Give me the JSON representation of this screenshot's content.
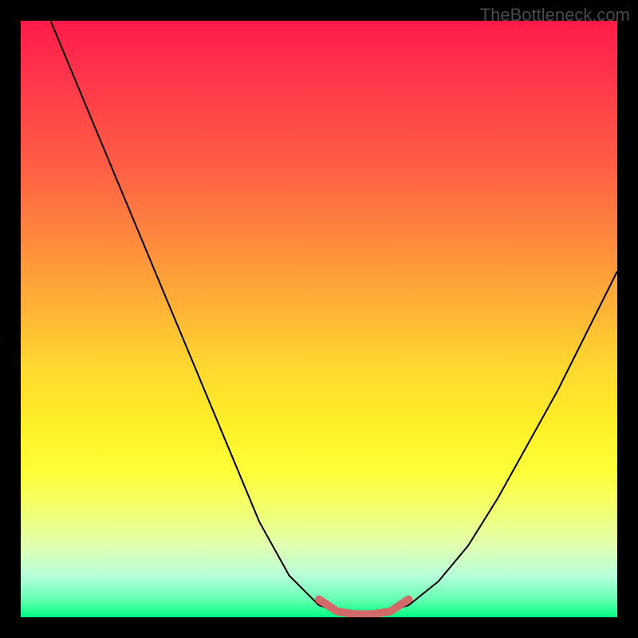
{
  "watermark": "TheBottleneck.com",
  "chart_data": {
    "type": "line",
    "title": "",
    "xlabel": "",
    "ylabel": "",
    "xlim": [
      0,
      100
    ],
    "ylim": [
      0,
      100
    ],
    "grid": false,
    "legend": false,
    "annotations": [],
    "series": [
      {
        "name": "main-curve",
        "stroke": "#000000",
        "points": [
          {
            "x": 5,
            "y": 100
          },
          {
            "x": 10,
            "y": 88
          },
          {
            "x": 15,
            "y": 76
          },
          {
            "x": 20,
            "y": 64
          },
          {
            "x": 25,
            "y": 52
          },
          {
            "x": 30,
            "y": 40
          },
          {
            "x": 35,
            "y": 28
          },
          {
            "x": 40,
            "y": 16
          },
          {
            "x": 45,
            "y": 7
          },
          {
            "x": 50,
            "y": 2
          },
          {
            "x": 55,
            "y": 0.5
          },
          {
            "x": 60,
            "y": 0.5
          },
          {
            "x": 65,
            "y": 2
          },
          {
            "x": 70,
            "y": 6
          },
          {
            "x": 75,
            "y": 12
          },
          {
            "x": 80,
            "y": 20
          },
          {
            "x": 85,
            "y": 29
          },
          {
            "x": 90,
            "y": 38
          },
          {
            "x": 95,
            "y": 48
          },
          {
            "x": 100,
            "y": 58
          }
        ]
      },
      {
        "name": "valley-highlight",
        "stroke": "#d26a6a",
        "points": [
          {
            "x": 50,
            "y": 3
          },
          {
            "x": 53,
            "y": 1
          },
          {
            "x": 56,
            "y": 0.5
          },
          {
            "x": 59,
            "y": 0.5
          },
          {
            "x": 62,
            "y": 1
          },
          {
            "x": 65,
            "y": 3
          }
        ]
      }
    ],
    "background_gradient": {
      "type": "vertical",
      "stops": [
        {
          "pos": 0,
          "color": "#ff1a4a"
        },
        {
          "pos": 25,
          "color": "#ff6044"
        },
        {
          "pos": 50,
          "color": "#ffb236"
        },
        {
          "pos": 70,
          "color": "#fff028"
        },
        {
          "pos": 90,
          "color": "#e0ffb0"
        },
        {
          "pos": 100,
          "color": "#00ff80"
        }
      ]
    }
  }
}
